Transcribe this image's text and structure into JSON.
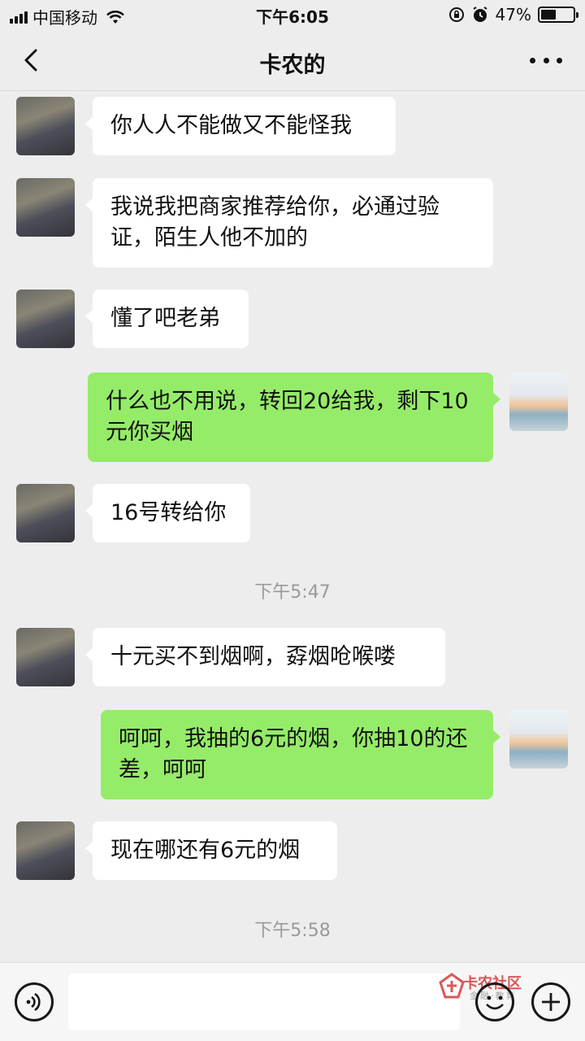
{
  "status_bar": {
    "carrier": "中国移动",
    "time": "下午6:05",
    "battery_percent": "47%",
    "battery_level": 0.47
  },
  "header": {
    "title": "卡农的"
  },
  "messages": [
    {
      "side": "in",
      "text": "你人人不能做又不能怪我"
    },
    {
      "side": "in",
      "text": "我说我把商家推荐给你，必通过验证，陌生人他不加的"
    },
    {
      "side": "in",
      "text": "懂了吧老弟"
    },
    {
      "side": "out",
      "text": "什么也不用说，转回20给我，剩下10元你买烟"
    },
    {
      "side": "in",
      "text": "16号转给你"
    },
    {
      "type": "time",
      "text": "下午5:47"
    },
    {
      "side": "in",
      "text": "十元买不到烟啊，孬烟呛喉喽"
    },
    {
      "side": "out",
      "text": "呵呵，我抽的6元的烟，你抽10的还差，呵呵"
    },
    {
      "side": "in",
      "text": "现在哪还有6元的烟"
    },
    {
      "type": "time",
      "text": "下午5:58"
    }
  ],
  "input_bar": {
    "watermark_text": "卡农社区",
    "watermark_sub": "金融·教育",
    "icons": [
      "voice-icon",
      "emoji-icon",
      "plus-icon"
    ]
  },
  "colors": {
    "background": "#ededed",
    "incoming_bubble": "#ffffff",
    "outgoing_bubble": "#95ec69",
    "timestamp": "#9a9a9a"
  }
}
